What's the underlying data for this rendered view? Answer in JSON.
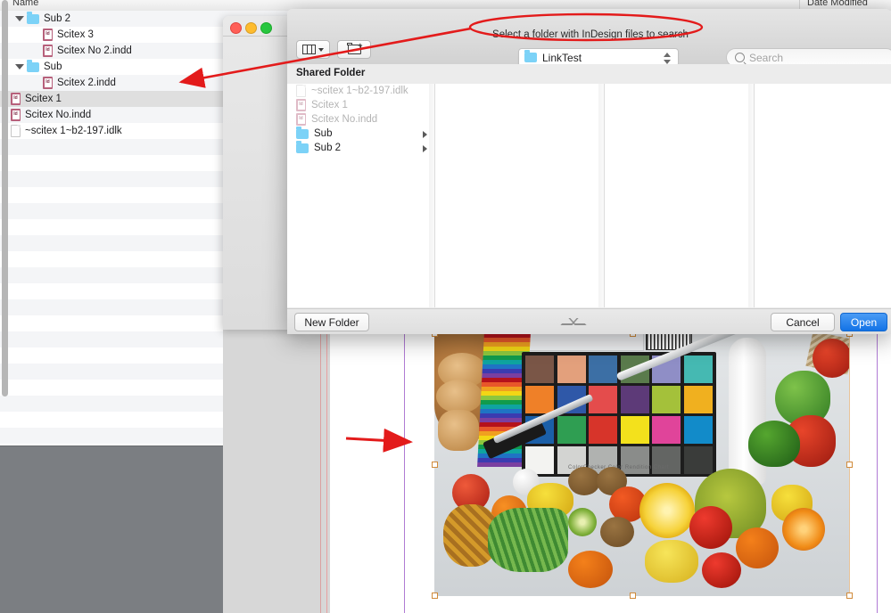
{
  "background_window": {
    "columns": [
      "Name",
      "Date Modified"
    ],
    "rows": [
      {
        "label": "Sub 2",
        "icon": "folder-icon",
        "indent": 1,
        "disclosure": "expanded",
        "selected": false
      },
      {
        "label": "Scitex 3",
        "icon": "indesign-file-icon",
        "indent": 2,
        "disclosure": "none",
        "selected": false
      },
      {
        "label": "Scitex No 2.indd",
        "icon": "indesign-file-icon",
        "indent": 2,
        "disclosure": "none",
        "selected": false
      },
      {
        "label": "Sub",
        "icon": "folder-icon",
        "indent": 1,
        "disclosure": "expanded",
        "selected": false
      },
      {
        "label": "Scitex 2.indd",
        "icon": "indesign-file-icon",
        "indent": 2,
        "disclosure": "none",
        "selected": false
      },
      {
        "label": "Scitex 1",
        "icon": "indesign-file-icon",
        "indent": 0,
        "disclosure": "none",
        "selected": true
      },
      {
        "label": "Scitex No.indd",
        "icon": "indesign-file-icon",
        "indent": 0,
        "disclosure": "none",
        "selected": false
      },
      {
        "label": "~scitex 1~b2-197.idlk",
        "icon": "generic-document-icon",
        "indent": 0,
        "disclosure": "none",
        "selected": false
      }
    ]
  },
  "dialog": {
    "message": "Select a folder with InDesign files to search",
    "window_controls": {
      "close": "close-button",
      "minimize": "minimize-button",
      "zoom": "zoom-button"
    },
    "toolbar": {
      "view_mode": "column-view",
      "new_folder_icon": "new-folder-icon"
    },
    "path_popup": {
      "label": "LinkTest",
      "icon": "folder-icon"
    },
    "search": {
      "placeholder": "Search",
      "value": ""
    },
    "section_header": "Shared Folder",
    "column1_items": [
      {
        "label": "~scitex 1~b2-197.idlk",
        "icon": "generic-document-icon",
        "enabled": false,
        "has_children": false
      },
      {
        "label": "Scitex 1",
        "icon": "indesign-file-icon",
        "enabled": false,
        "has_children": false
      },
      {
        "label": "Scitex No.indd",
        "icon": "indesign-file-icon",
        "enabled": false,
        "has_children": false
      },
      {
        "label": "Sub",
        "icon": "folder-icon",
        "enabled": true,
        "has_children": true
      },
      {
        "label": "Sub 2",
        "icon": "folder-icon",
        "enabled": true,
        "has_children": true
      }
    ],
    "footer": {
      "new_folder_label": "New Folder",
      "cancel_label": "Cancel",
      "open_label": "Open",
      "resize_handle": "resize-chevron-icon"
    }
  },
  "annotations": {
    "accent_color": "#e31b1b",
    "ellipse": {
      "target": "Select a folder with InDesign files to search"
    },
    "arrow_1": {
      "from": "dialog-message-ellipse",
      "to": "scitex-2-indd-row"
    },
    "arrow_2": {
      "from": "pasteboard-left",
      "to": "selected-image-frame-left-handle"
    }
  },
  "indesign_document": {
    "selected_frame": "placed-image-frame",
    "image_description": "color-checker-with-food-and-objects",
    "colorchecker_swatches": [
      [
        "#7a5647",
        "#e3a07c",
        "#3c6fa5",
        "#5a7b4c",
        "#8f8ec6",
        "#45b9b2"
      ],
      [
        "#ef8028",
        "#2f58a8",
        "#e44c4c",
        "#5d3a78",
        "#a4c13a",
        "#f0b01f"
      ],
      [
        "#1b5fa8",
        "#2f9e52",
        "#d7342a",
        "#f3e11c",
        "#e0449a",
        "#128bc9"
      ],
      [
        "#f3f3f1",
        "#d3d4d2",
        "#b0b2b0",
        "#8a8c8a",
        "#636563",
        "#3a3c3a"
      ]
    ],
    "colorchecker_caption": "ColorChecker Color Rendition Chart"
  }
}
